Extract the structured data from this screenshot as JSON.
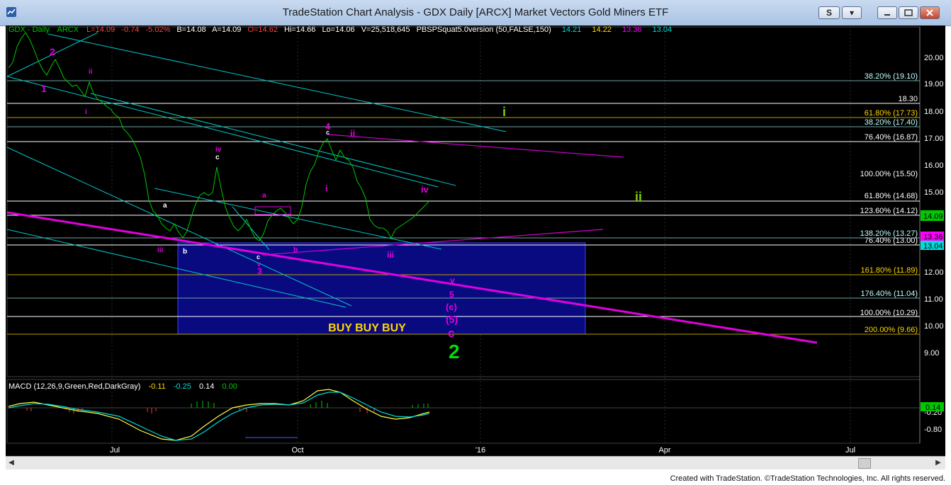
{
  "window": {
    "title": "TradeStation Chart Analysis - GDX Daily [ARCX] Market Vectors Gold Miners ETF",
    "buttons": {
      "s": "S",
      "dropdown": "▾",
      "minimize": "",
      "restore": "",
      "close": ""
    }
  },
  "footer": {
    "credit": "Created with TradeStation. ©TradeStation Technologies, Inc. All rights reserved."
  },
  "header": {
    "symbol": "GDX - Daily",
    "exchange": "ARCX",
    "last": "L=14.09",
    "change": "-0.74",
    "change_pct": "-5.02%",
    "bid": "B=14.08",
    "ask": "A=14.09",
    "open": "O=14.62",
    "high": "Hi=14.66",
    "low": "Lo=14.06",
    "volume": "V=25,518,645",
    "indicator": "PBSPSquat5.0version (50,FALSE,150)",
    "ind_values": [
      "14.21",
      "14.22",
      "13.36",
      "13.04"
    ]
  },
  "price_axis": {
    "ticks": [
      "20.00",
      "19.00",
      "18.00",
      "17.00",
      "16.00",
      "15.00",
      "12.00",
      "11.00",
      "10.00",
      "9.00"
    ],
    "badges": [
      {
        "text": "14.09",
        "color": "#00c800"
      },
      {
        "text": "13.36",
        "color": "#ff00ff"
      },
      {
        "text": "13.04",
        "color": "#00dcdc"
      }
    ]
  },
  "levels": [
    {
      "label": "38.20% (19.10)",
      "color": "#c0ffff"
    },
    {
      "label": "18.30",
      "color": "#ffffff"
    },
    {
      "label": "61.80% (17.73)",
      "color": "#ffd700"
    },
    {
      "label": "38.20% (17.40)",
      "color": "#c0ffff"
    },
    {
      "label": "76.40% (16.87)",
      "color": "#ffffff"
    },
    {
      "label": "100.00% (15.50)",
      "color": "#ffffff"
    },
    {
      "label": "61.80% (14.68)",
      "color": "#ffffff"
    },
    {
      "label": "123.60% (14.12)",
      "color": "#ffffff"
    },
    {
      "label": "138.20% (13.27)",
      "color": "#c0ffff"
    },
    {
      "label": "76.40% (13.00)",
      "color": "#ffffff"
    },
    {
      "label": "161.80% (11.89)",
      "color": "#ffd700"
    },
    {
      "label": "176.40% (11.04)",
      "color": "#c0ffff"
    },
    {
      "label": "100.00% (10.29)",
      "color": "#ffffff"
    },
    {
      "label": "200.00% (9.66)",
      "color": "#ffd700"
    }
  ],
  "wave_labels": {
    "ones": [
      "1",
      "i",
      "i",
      "i"
    ],
    "twos": [
      "2",
      "ii",
      "ii",
      "2"
    ],
    "threes": [
      "3",
      "iii",
      "iii"
    ],
    "fours": [
      "4",
      "iv",
      "iv"
    ],
    "abc": [
      "a",
      "b",
      "c",
      "a",
      "b",
      "c",
      "a",
      "b",
      "c",
      "v",
      "v",
      "5",
      "(c)",
      "(5)",
      "c"
    ]
  },
  "buy_box": {
    "text": "BUY  BUY  BUY"
  },
  "time_axis": {
    "labels": [
      "Jul",
      "Oct",
      "'16",
      "Apr",
      "Jul"
    ]
  },
  "macd": {
    "label": "MACD (12,26,9,Green,Red,DarkGray)",
    "values": [
      "-0.11",
      "-0.25",
      "0.14",
      "0.00"
    ],
    "ticks": [
      "-0.20",
      "-0.80"
    ],
    "badge": "0.14"
  }
}
